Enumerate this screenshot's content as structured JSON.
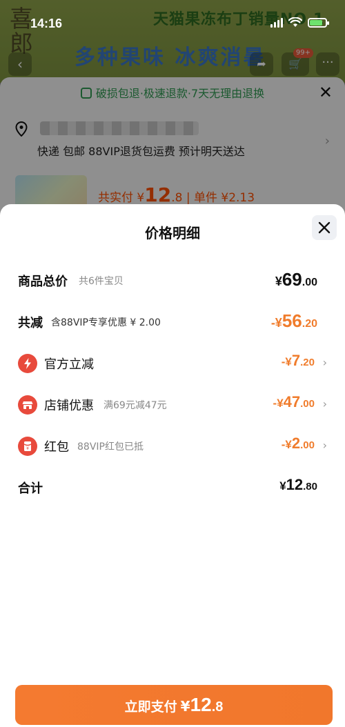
{
  "status_bar": {
    "time": "14:16"
  },
  "background_page": {
    "banner_top": "天猫果冻布丁销量NO.1",
    "banner_main": "多种果味 冰爽消暑",
    "cart_badge": "99+",
    "guarantee": "破损包退·极速退款·7天无理由退换",
    "shipping": "快递 包邮 88VIP退货包运费 预计明天送达",
    "item_price_prefix": "共实付 ¥",
    "item_price_int": "12",
    "item_price_dec": ".8",
    "item_unit": "| 单件 ¥2.13"
  },
  "sheet": {
    "title": "价格明细",
    "rows": [
      {
        "label": "商品总价",
        "sub": "共6件宝贝",
        "currency": "¥",
        "int": "69",
        "dec": ".00"
      },
      {
        "label": "共减",
        "sub": "含88VIP专享优惠 ¥ 2.00",
        "currency": "-¥",
        "int": "56",
        "dec": ".20"
      },
      {
        "label": "官方立减",
        "sub": "",
        "currency": "-¥",
        "int": "7",
        "dec": ".20",
        "icon": "lightning-icon"
      },
      {
        "label": "店铺优惠",
        "sub": "满69元减47元",
        "currency": "-¥",
        "int": "47",
        "dec": ".00",
        "icon": "store-icon"
      },
      {
        "label": "红包",
        "sub": "88VIP红包已抵",
        "currency": "-¥",
        "int": "2",
        "dec": ".00",
        "icon": "red-envelope-icon"
      },
      {
        "label": "合计",
        "sub": "",
        "currency": "¥",
        "int": "12",
        "dec": ".80"
      }
    ]
  },
  "pay_button": {
    "label": "立即支付",
    "currency": "¥",
    "int": "12",
    "dec": ".8"
  },
  "colors": {
    "accent_orange": "#f07c2c",
    "icon_red": "#e84a3c",
    "guarantee_green": "#2f9a52"
  }
}
